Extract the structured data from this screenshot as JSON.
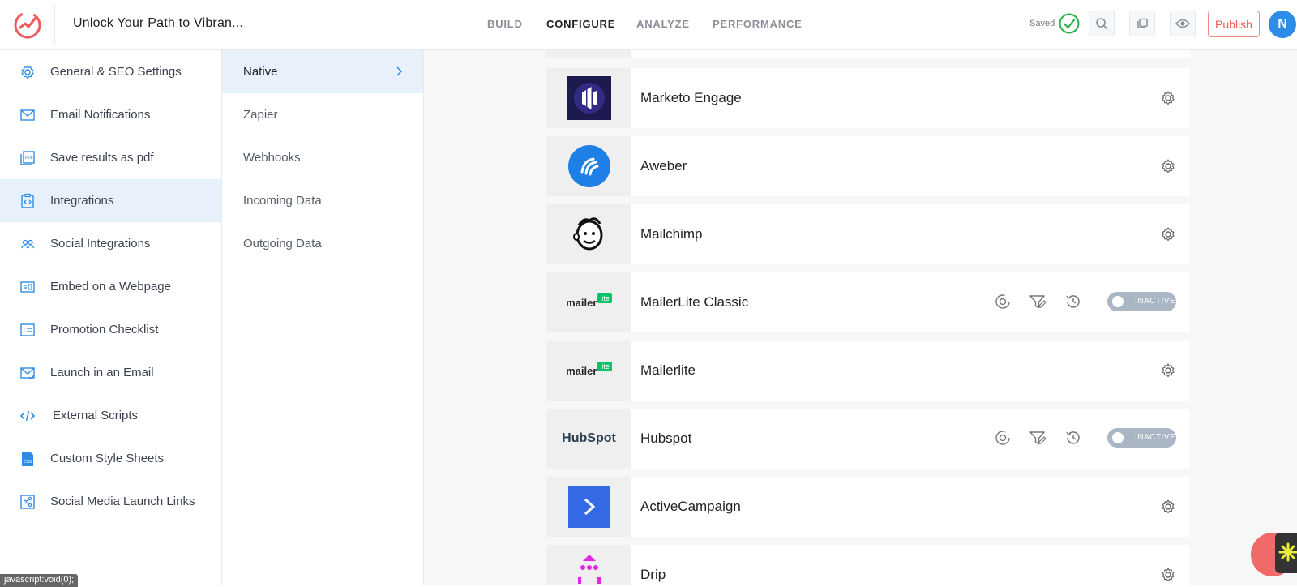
{
  "header": {
    "title": "Unlock Your Path to Vibran...",
    "nav": [
      "BUILD",
      "CONFIGURE",
      "ANALYZE",
      "PERFORMANCE"
    ],
    "active_nav": "CONFIGURE",
    "saved_label": "Saved",
    "publish_label": "Publish",
    "avatar_initial": "N"
  },
  "sidebar": {
    "items": [
      {
        "label": "General & SEO Settings",
        "icon": "gear-icon"
      },
      {
        "label": "Email Notifications",
        "icon": "envelope-icon"
      },
      {
        "label": "Save results as pdf",
        "icon": "pdf-icon"
      },
      {
        "label": "Integrations",
        "icon": "integrations-icon",
        "active": true
      },
      {
        "label": "Social Integrations",
        "icon": "users-icon"
      },
      {
        "label": "Embed on a Webpage",
        "icon": "embed-icon"
      },
      {
        "label": "Promotion Checklist",
        "icon": "checklist-icon"
      },
      {
        "label": "Launch in an Email",
        "icon": "email-launch-icon"
      },
      {
        "label": "External Scripts",
        "icon": "code-icon"
      },
      {
        "label": "Custom Style Sheets",
        "icon": "css-file-icon"
      },
      {
        "label": "Social Media Launch Links",
        "icon": "share-icon"
      }
    ]
  },
  "submenu": {
    "items": [
      {
        "label": "Native",
        "active": true
      },
      {
        "label": "Zapier"
      },
      {
        "label": "Webhooks"
      },
      {
        "label": "Incoming Data"
      },
      {
        "label": "Outgoing Data"
      }
    ]
  },
  "integrations": [
    {
      "name": "Marketo Engage",
      "logo": "marketo-logo",
      "mode": "gear"
    },
    {
      "name": "Aweber",
      "logo": "aweber-logo",
      "mode": "gear"
    },
    {
      "name": "Mailchimp",
      "logo": "mailchimp-logo",
      "mode": "gear"
    },
    {
      "name": "MailerLite Classic",
      "logo": "mailerlite-logo",
      "logo_text": "mailer",
      "logo_badge": "lite",
      "mode": "toggle",
      "status": "INACTIVE"
    },
    {
      "name": "Mailerlite",
      "logo": "mailerlite-logo",
      "logo_text": "mailer",
      "logo_badge": "lite",
      "mode": "gear"
    },
    {
      "name": "Hubspot",
      "logo": "hubspot-logo",
      "logo_text": "HubSpot",
      "mode": "toggle",
      "status": "INACTIVE"
    },
    {
      "name": "ActiveCampaign",
      "logo": "activecampaign-logo",
      "mode": "gear"
    },
    {
      "name": "Drip",
      "logo": "drip-logo",
      "mode": "gear"
    }
  ],
  "status_bar": {
    "url": "javascript:void(0);"
  },
  "colors": {
    "accent": "#2d8ce8",
    "active_bg": "#e8f1fb",
    "publish": "#ef5a5a",
    "saved_check": "#2bb24c",
    "inactive_toggle": "#a9b6c4"
  }
}
